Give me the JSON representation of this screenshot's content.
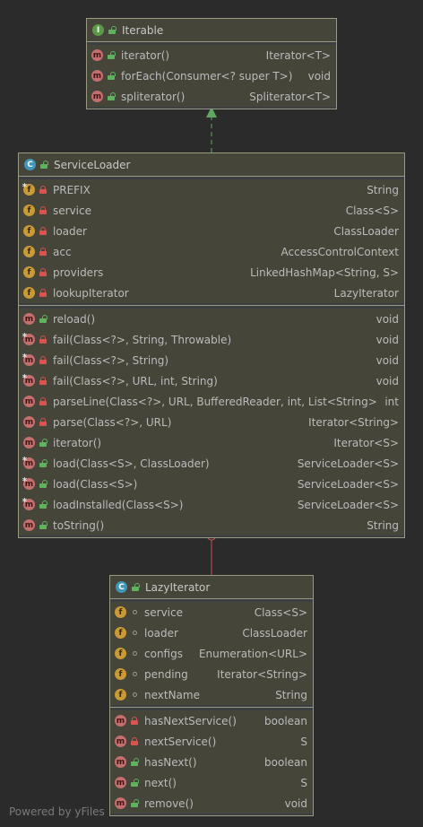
{
  "footer": "Powered by yFiles",
  "colors": {
    "background": "#2b2b2b",
    "class_border": "#9a9a82",
    "implements_link": "#5fa85f",
    "inner_link": "#c0504d"
  },
  "classes": [
    {
      "name": "Iterable",
      "kind": "interface",
      "kind_icon": "interface-icon",
      "kind_letter": "I",
      "sections": [
        [
          {
            "name": "iterator()",
            "type": "Iterator<T>",
            "kind": "method",
            "vis": "public"
          },
          {
            "name": "forEach(Consumer<? super T>)",
            "type": "void",
            "kind": "method",
            "vis": "public"
          },
          {
            "name": "spliterator()",
            "type": "Spliterator<T>",
            "kind": "method",
            "vis": "public"
          }
        ]
      ]
    },
    {
      "name": "ServiceLoader",
      "kind": "class",
      "kind_icon": "class-icon",
      "kind_letter": "C",
      "sections": [
        [
          {
            "name": "PREFIX",
            "type": "String",
            "kind": "field",
            "vis": "private",
            "static": true
          },
          {
            "name": "service",
            "type": "Class<S>",
            "kind": "field",
            "vis": "private"
          },
          {
            "name": "loader",
            "type": "ClassLoader",
            "kind": "field",
            "vis": "private"
          },
          {
            "name": "acc",
            "type": "AccessControlContext",
            "kind": "field",
            "vis": "private"
          },
          {
            "name": "providers",
            "type": "LinkedHashMap<String, S>",
            "kind": "field",
            "vis": "private"
          },
          {
            "name": "lookupIterator",
            "type": "LazyIterator",
            "kind": "field",
            "vis": "private"
          }
        ],
        [
          {
            "name": "reload()",
            "type": "void",
            "kind": "method",
            "vis": "public"
          },
          {
            "name": "fail(Class<?>, String, Throwable)",
            "type": "void",
            "kind": "method",
            "vis": "private",
            "static": true
          },
          {
            "name": "fail(Class<?>, String)",
            "type": "void",
            "kind": "method",
            "vis": "private",
            "static": true
          },
          {
            "name": "fail(Class<?>, URL, int, String)",
            "type": "void",
            "kind": "method",
            "vis": "private",
            "static": true
          },
          {
            "name": "parseLine(Class<?>, URL, BufferedReader, int, List<String>)",
            "type": "int",
            "kind": "method",
            "vis": "private"
          },
          {
            "name": "parse(Class<?>, URL)",
            "type": "Iterator<String>",
            "kind": "method",
            "vis": "private"
          },
          {
            "name": "iterator()",
            "type": "Iterator<S>",
            "kind": "method",
            "vis": "public"
          },
          {
            "name": "load(Class<S>, ClassLoader)",
            "type": "ServiceLoader<S>",
            "kind": "method",
            "vis": "public",
            "static": true
          },
          {
            "name": "load(Class<S>)",
            "type": "ServiceLoader<S>",
            "kind": "method",
            "vis": "public",
            "static": true
          },
          {
            "name": "loadInstalled(Class<S>)",
            "type": "ServiceLoader<S>",
            "kind": "method",
            "vis": "public",
            "static": true
          },
          {
            "name": "toString()",
            "type": "String",
            "kind": "method",
            "vis": "public"
          }
        ]
      ]
    },
    {
      "name": "LazyIterator",
      "kind": "class",
      "kind_icon": "class-icon",
      "kind_letter": "C",
      "sections": [
        [
          {
            "name": "service",
            "type": "Class<S>",
            "kind": "field",
            "vis": "package"
          },
          {
            "name": "loader",
            "type": "ClassLoader",
            "kind": "field",
            "vis": "package"
          },
          {
            "name": "configs",
            "type": "Enumeration<URL>",
            "kind": "field",
            "vis": "package"
          },
          {
            "name": "pending",
            "type": "Iterator<String>",
            "kind": "field",
            "vis": "package"
          },
          {
            "name": "nextName",
            "type": "String",
            "kind": "field",
            "vis": "package"
          }
        ],
        [
          {
            "name": "hasNextService()",
            "type": "boolean",
            "kind": "method",
            "vis": "private"
          },
          {
            "name": "nextService()",
            "type": "S",
            "kind": "method",
            "vis": "private"
          },
          {
            "name": "hasNext()",
            "type": "boolean",
            "kind": "method",
            "vis": "public"
          },
          {
            "name": "next()",
            "type": "S",
            "kind": "method",
            "vis": "public"
          },
          {
            "name": "remove()",
            "type": "void",
            "kind": "method",
            "vis": "public"
          }
        ]
      ]
    }
  ]
}
